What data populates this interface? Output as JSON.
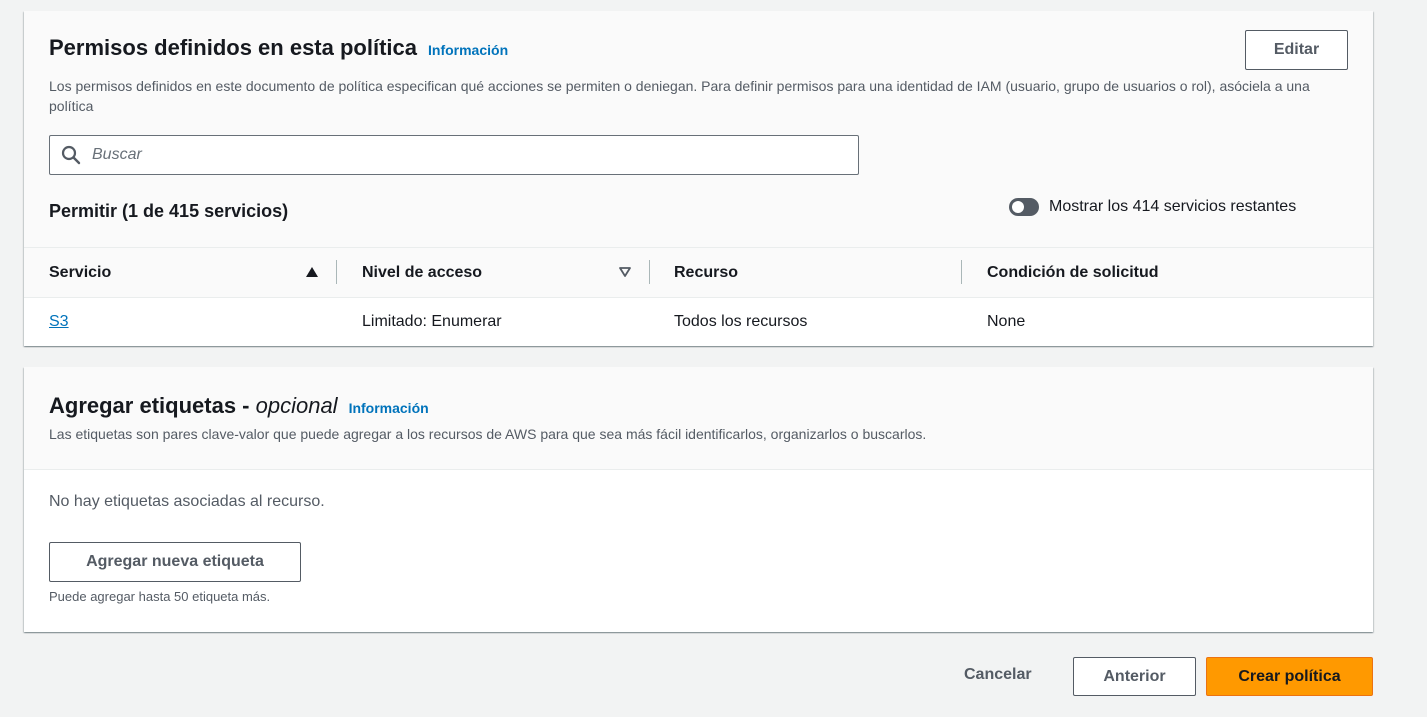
{
  "permissions_panel": {
    "title": "Permisos definidos en esta política",
    "info_link": "Información",
    "description": "Los permisos definidos en este documento de política especifican qué acciones se permiten o deniegan. Para definir permisos para una identidad de IAM (usuario, grupo de usuarios o rol), asóciela a una política",
    "edit_button": "Editar",
    "search_placeholder": "Buscar",
    "allow_heading": "Permitir (1 de 415 servicios)",
    "toggle_label": "Mostrar los 414 servicios restantes",
    "toggle_on": false,
    "columns": [
      "Servicio",
      "Nivel de acceso",
      "Recurso",
      "Condición de solicitud"
    ],
    "rows": [
      {
        "service": "S3",
        "access_level": "Limitado: Enumerar",
        "resource": "Todos los recursos",
        "condition": "None"
      }
    ]
  },
  "tags_panel": {
    "title": "Agregar etiquetas - ",
    "title_optional": "opcional",
    "info_link": "Información",
    "description": "Las etiquetas son pares clave-valor que puede agregar a los recursos de AWS para que sea más fácil identificarlos, organizarlos o buscarlos.",
    "empty_text": "No hay etiquetas asociadas al recurso.",
    "add_button": "Agregar nueva etiqueta",
    "hint": "Puede agregar hasta 50 etiqueta más."
  },
  "footer": {
    "cancel": "Cancelar",
    "previous": "Anterior",
    "create": "Crear política"
  },
  "colors": {
    "primary_button": "#ff9900",
    "link": "#0073bb",
    "background": "#f2f3f3"
  }
}
